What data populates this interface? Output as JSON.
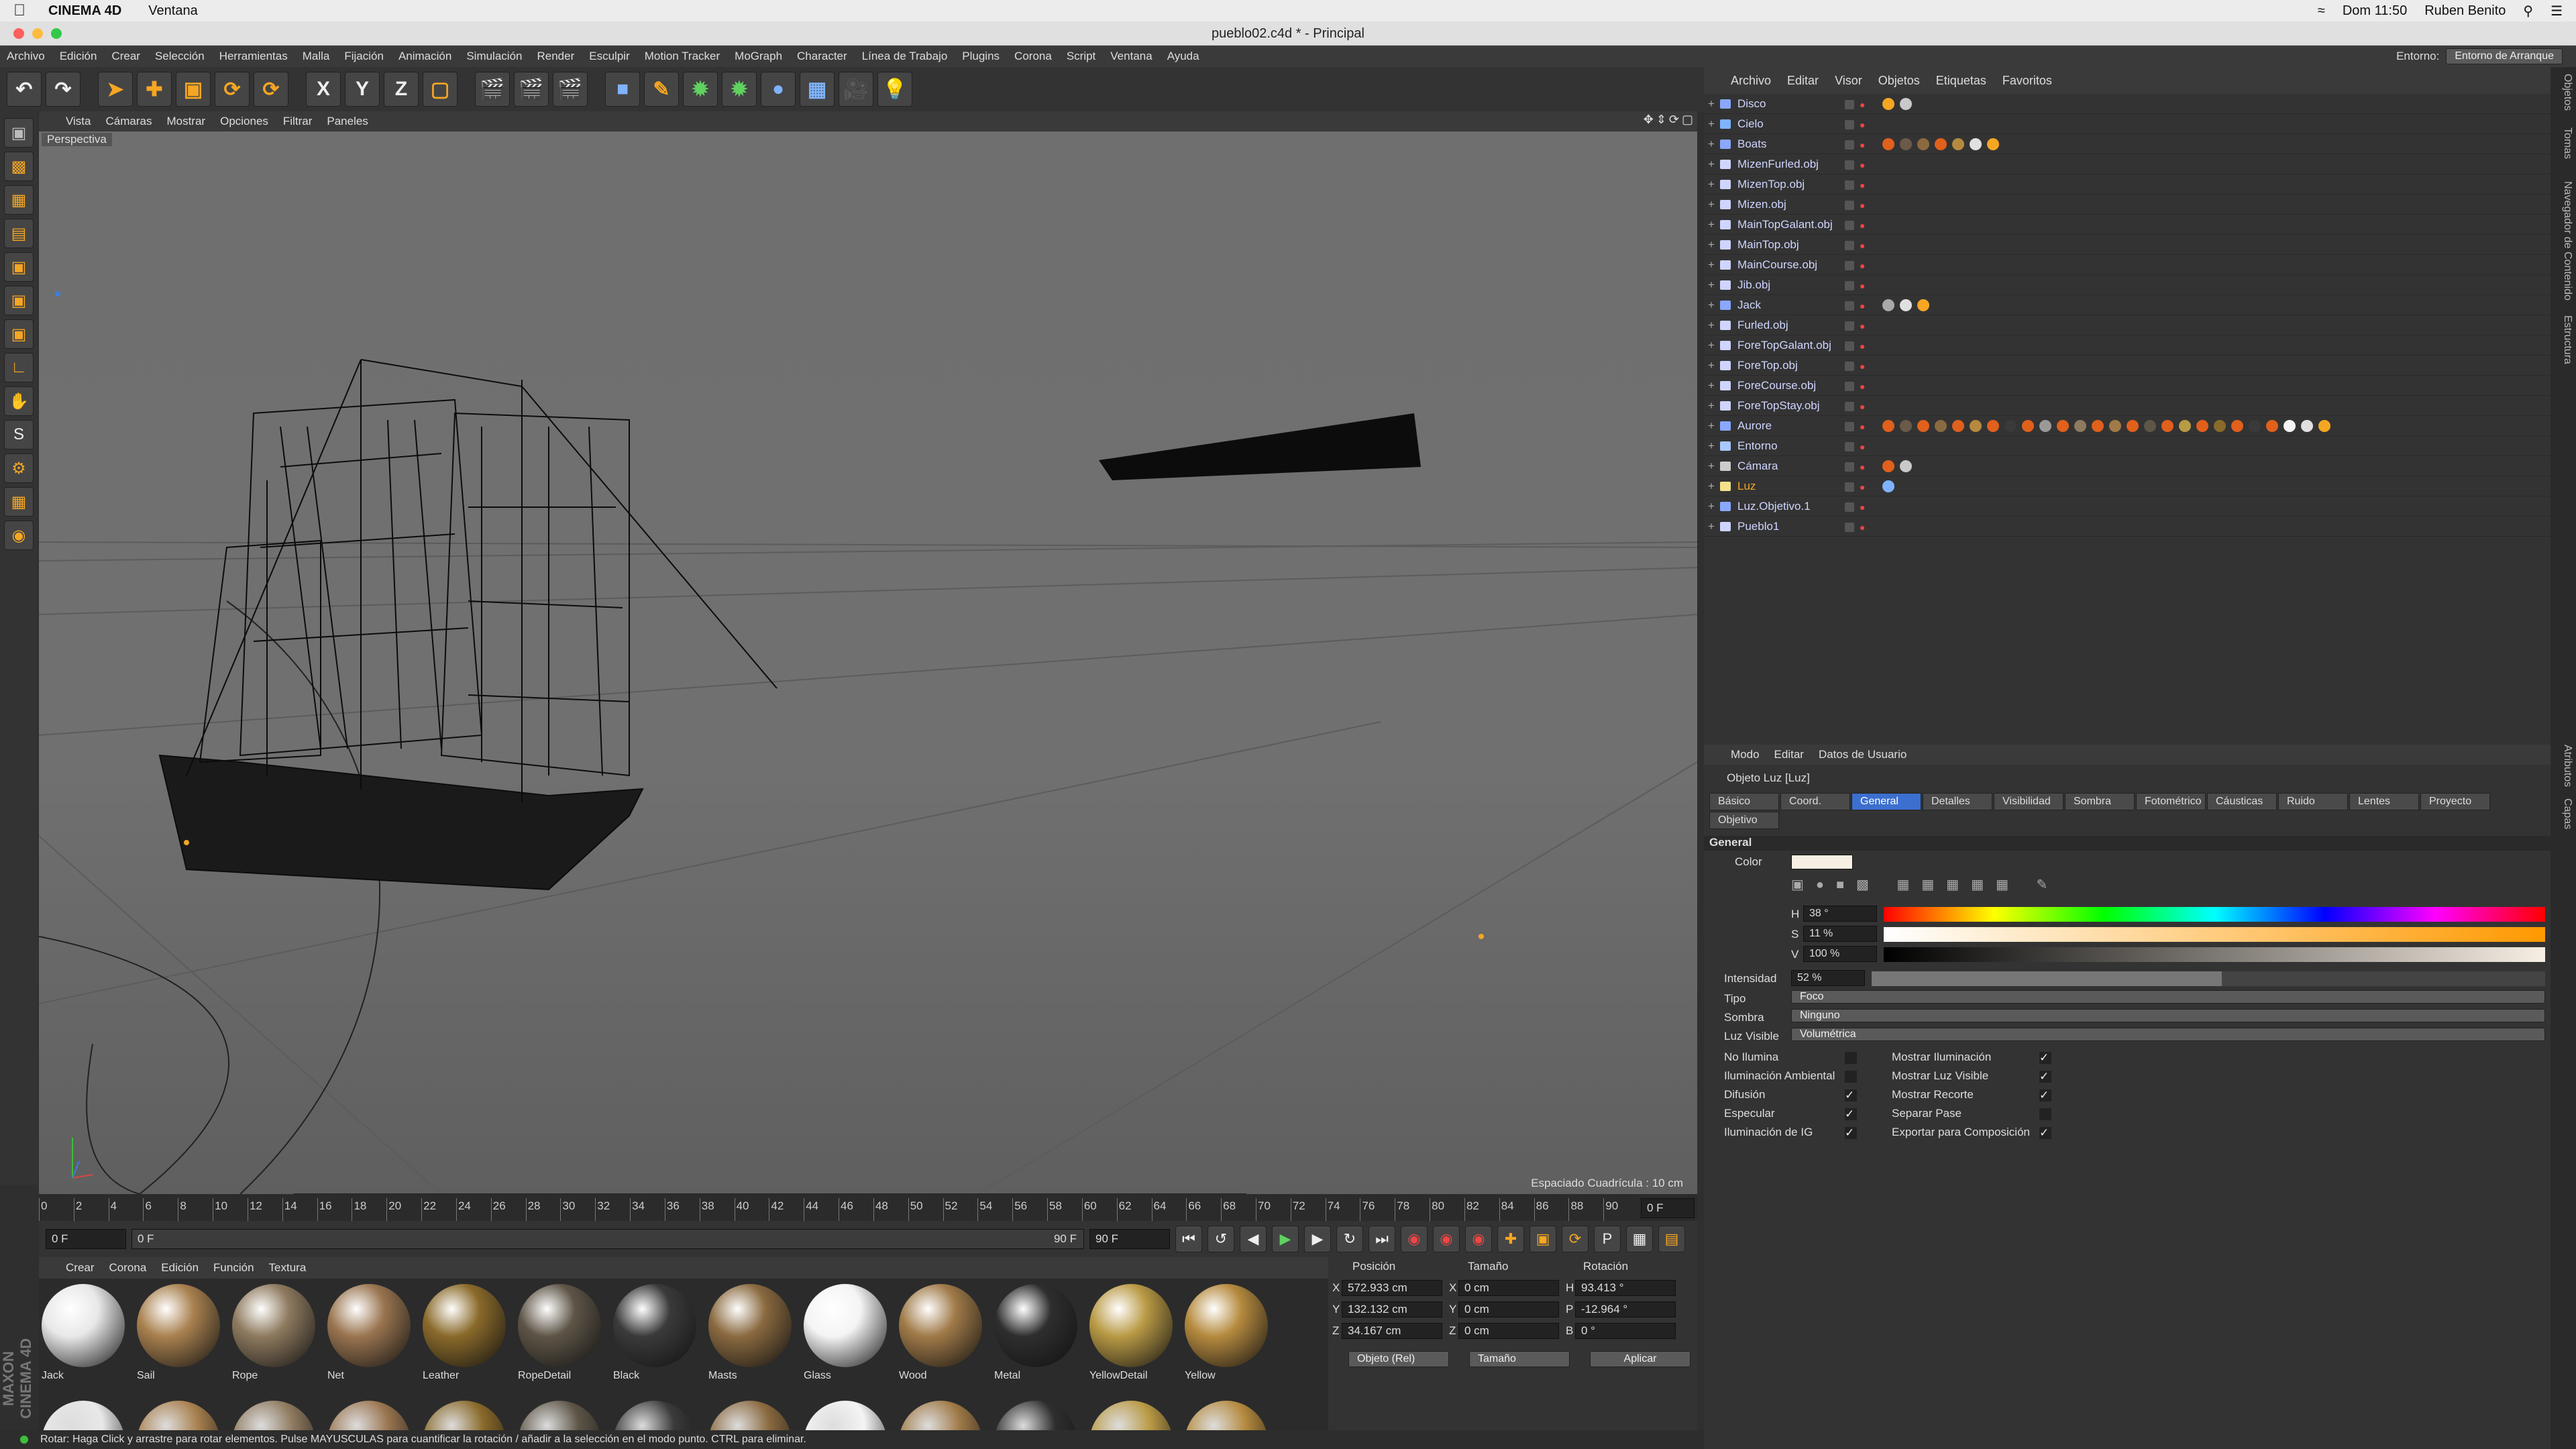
{
  "macos": {
    "app_name": "CINEMA 4D",
    "menu_item": "Ventana",
    "clock": "Dom 11:50",
    "user": "Ruben Benito"
  },
  "window": {
    "title": "pueblo02.c4d * - Principal"
  },
  "main_menu": [
    "Archivo",
    "Edición",
    "Crear",
    "Selección",
    "Herramientas",
    "Malla",
    "Fijación",
    "Animación",
    "Simulación",
    "Render",
    "Esculpir",
    "Motion Tracker",
    "MoGraph",
    "Character",
    "Línea de Trabajo",
    "Plugins",
    "Corona",
    "Script",
    "Ventana",
    "Ayuda"
  ],
  "environment": {
    "label": "Entorno:",
    "value": "Entorno de Arranque"
  },
  "viewport": {
    "menu": [
      "Vista",
      "Cámaras",
      "Mostrar",
      "Opciones",
      "Filtrar",
      "Paneles"
    ],
    "label": "Perspectiva",
    "grid_spacing": "Espaciado Cuadrícula : 10 cm"
  },
  "timeline": {
    "ticks": [
      "0",
      "2",
      "4",
      "6",
      "8",
      "10",
      "12",
      "14",
      "16",
      "18",
      "20",
      "22",
      "24",
      "26",
      "28",
      "30",
      "32",
      "34",
      "36",
      "38",
      "40",
      "42",
      "44",
      "46",
      "48",
      "50",
      "52",
      "54",
      "56",
      "58",
      "60",
      "62",
      "64",
      "66",
      "68",
      "70",
      "72",
      "74",
      "76",
      "78",
      "80",
      "82",
      "84",
      "86",
      "88",
      "90"
    ],
    "current_field": "0 F",
    "start": "0 F",
    "range_start": "0 F",
    "range_end": "90 F",
    "end": "90 F",
    "end_label": "0 F"
  },
  "materials": {
    "menu": [
      "Crear",
      "Corona",
      "Edición",
      "Función",
      "Textura"
    ],
    "items": [
      {
        "name": "Jack",
        "color": "#e8e8e8"
      },
      {
        "name": "Sail",
        "color": "#a9814f"
      },
      {
        "name": "Rope",
        "color": "#8e7a5f"
      },
      {
        "name": "Net",
        "color": "#9a7550"
      },
      {
        "name": "Leather",
        "color": "#8a6a2a"
      },
      {
        "name": "RopeDetail",
        "color": "#5e5547"
      },
      {
        "name": "Black",
        "color": "#3a3a3a"
      },
      {
        "name": "Masts",
        "color": "#8a6a40"
      },
      {
        "name": "Glass",
        "color": "#f4f4f4"
      },
      {
        "name": "Wood",
        "color": "#a07a48"
      },
      {
        "name": "Metal",
        "color": "#2e2e2e"
      },
      {
        "name": "YellowDetail",
        "color": "#b99a45"
      },
      {
        "name": "Yellow",
        "color": "#b58a3e"
      }
    ]
  },
  "coords": {
    "headers": [
      "Posición",
      "Tamaño",
      "Rotación"
    ],
    "rows": [
      {
        "axis": "X",
        "pos": "572.933 cm",
        "size_axis": "X",
        "size": "0 cm",
        "rot_axis": "H",
        "rot": "93.413 °"
      },
      {
        "axis": "Y",
        "pos": "132.132 cm",
        "size_axis": "Y",
        "size": "0 cm",
        "rot_axis": "P",
        "rot": "-12.964 °"
      },
      {
        "axis": "Z",
        "pos": "34.167 cm",
        "size_axis": "Z",
        "size": "0 cm",
        "rot_axis": "B",
        "rot": "0 °"
      }
    ],
    "mode": "Objeto (Rel)",
    "size_mode": "Tamaño",
    "apply": "Aplicar"
  },
  "status": "Rotar: Haga Click y arrastre para rotar elementos. Pulse MAYUSCULAS para cuantificar la rotación / añadir a la selección en el modo punto. CTRL para eliminar.",
  "logo": "MAXON CINEMA 4D",
  "objects": {
    "menu": [
      "Archivo",
      "Editar",
      "Visor",
      "Objetos",
      "Etiquetas",
      "Favoritos"
    ],
    "items": [
      {
        "name": "Disco",
        "type": "null",
        "tags": [
          "#f5a623",
          "#c9c9c9"
        ]
      },
      {
        "name": "Cielo",
        "type": "sky",
        "tags": []
      },
      {
        "name": "Boats",
        "type": "null",
        "tags": [
          "#e0601c",
          "#6b5a4a",
          "#8a6a40",
          "#e0601c",
          "#b58a3e",
          "#e0e0e0",
          "#f5a623"
        ]
      },
      {
        "name": "MizenFurled.obj",
        "type": "poly",
        "tags": []
      },
      {
        "name": "MizenTop.obj",
        "type": "poly",
        "tags": []
      },
      {
        "name": "Mizen.obj",
        "type": "poly",
        "tags": []
      },
      {
        "name": "MainTopGalant.obj",
        "type": "poly",
        "tags": []
      },
      {
        "name": "MainTop.obj",
        "type": "poly",
        "tags": []
      },
      {
        "name": "MainCourse.obj",
        "type": "poly",
        "tags": []
      },
      {
        "name": "Jib.obj",
        "type": "poly",
        "tags": []
      },
      {
        "name": "Jack",
        "type": "null",
        "tags": [
          "#a9a9a9",
          "#e0e0e0",
          "#f5a623"
        ]
      },
      {
        "name": "Furled.obj",
        "type": "poly",
        "tags": []
      },
      {
        "name": "ForeTopGalant.obj",
        "type": "poly",
        "tags": []
      },
      {
        "name": "ForeTop.obj",
        "type": "poly",
        "tags": []
      },
      {
        "name": "ForeCourse.obj",
        "type": "poly",
        "tags": []
      },
      {
        "name": "ForeTopStay.obj",
        "type": "poly",
        "tags": []
      },
      {
        "name": "Aurore",
        "type": "null",
        "tags": [
          "#e0601c",
          "#6b5a4a",
          "#e0601c",
          "#8a6a40",
          "#e0601c",
          "#b58a3e",
          "#e0601c",
          "#3a3a3a",
          "#e0601c",
          "#9a9a9a",
          "#e0601c",
          "#8e7a5f",
          "#e0601c",
          "#a07a48",
          "#e0601c",
          "#5e5547",
          "#e0601c",
          "#b99a45",
          "#e0601c",
          "#8a6a2a",
          "#e0601c",
          "#3a3a3a",
          "#e0601c",
          "#f4f4f4",
          "#e0e0e0",
          "#f5a623"
        ]
      },
      {
        "name": "Entorno",
        "type": "env",
        "tags": []
      },
      {
        "name": "Cámara",
        "type": "cam",
        "tags": [
          "#e0601c",
          "#c9c9c9"
        ]
      },
      {
        "name": "Luz",
        "type": "light",
        "selected": true,
        "tags": [
          "#7fb3ff"
        ]
      },
      {
        "name": "Luz.Objetivo.1",
        "type": "null",
        "tags": []
      },
      {
        "name": "Pueblo1",
        "type": "poly",
        "tags": []
      }
    ]
  },
  "attributes": {
    "menu": [
      "Modo",
      "Editar",
      "Datos de Usuario"
    ],
    "object_title": "Objeto Luz [Luz]",
    "tabs": [
      "Básico",
      "Coord.",
      "General",
      "Detalles",
      "Visibilidad",
      "Sombra",
      "Fotométrico",
      "Cáusticas",
      "Ruido",
      "Lentes",
      "Proyecto",
      "Objetivo"
    ],
    "active_tab": "General",
    "section": "General",
    "color_label": "Color",
    "color_value": "#f7efe4",
    "h_label": "H",
    "h_value": "38 °",
    "s_label": "S",
    "s_value": "11 %",
    "v_label": "V",
    "v_value": "100 %",
    "intensity_label": "Intensidad",
    "intensity_value": "52 %",
    "intensity_fraction": 0.52,
    "tipo_label": "Tipo",
    "tipo_value": "Foco",
    "sombra_label": "Sombra",
    "sombra_value": "Ninguno",
    "luzvis_label": "Luz Visible",
    "luzvis_value": "Volumétrica",
    "checks_left": [
      {
        "label": "No Ilumina",
        "checked": false
      },
      {
        "label": "Iluminación Ambiental",
        "checked": false
      },
      {
        "label": "Difusión",
        "checked": true
      },
      {
        "label": "Especular",
        "checked": true
      },
      {
        "label": "Iluminación de IG",
        "checked": true
      }
    ],
    "checks_right": [
      {
        "label": "Mostrar Iluminación",
        "checked": true
      },
      {
        "label": "Mostrar Luz Visible",
        "checked": true
      },
      {
        "label": "Mostrar Recorte",
        "checked": true
      },
      {
        "label": "Separar Pase",
        "checked": false
      },
      {
        "label": "Exportar para Composición",
        "checked": true
      }
    ]
  },
  "right_tabs": [
    "Objetos",
    "Tomas",
    "Navegador de Contenido",
    "Estructura",
    "Atributos",
    "Capas"
  ]
}
